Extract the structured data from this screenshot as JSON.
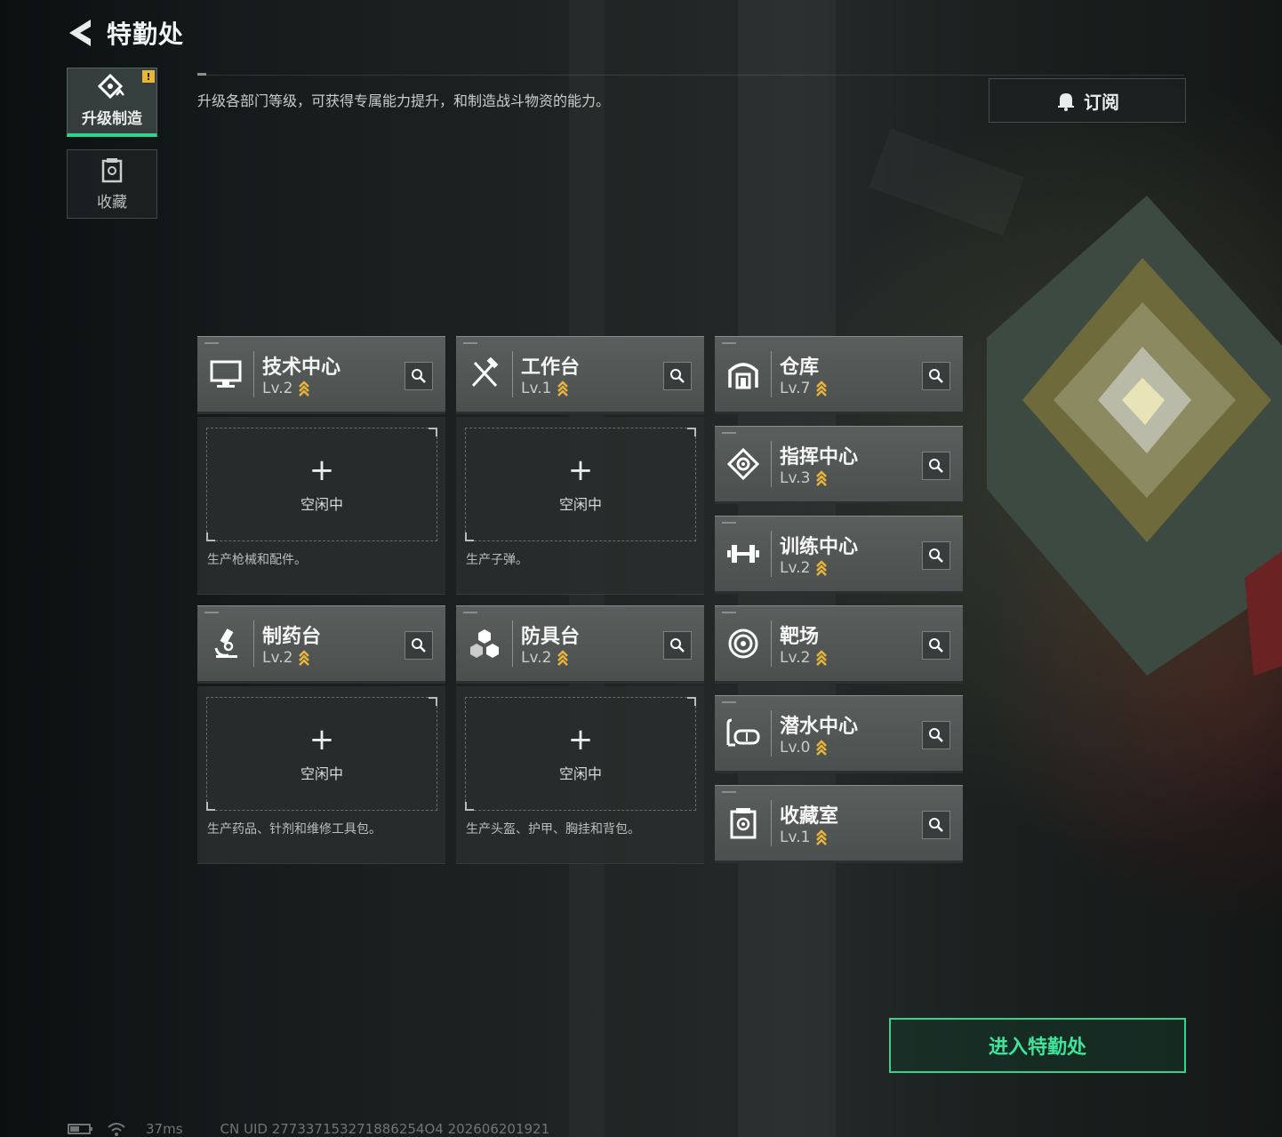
{
  "header": {
    "title": "特勤处",
    "back_icon": "back-arrow-icon"
  },
  "sidebar": {
    "tabs": [
      {
        "label": "升级制造",
        "icon": "upgrade-icon",
        "active": true,
        "badge": "!"
      },
      {
        "label": "收藏",
        "icon": "collection-icon",
        "active": false
      }
    ]
  },
  "description": "升级各部门等级，可获得专属能力提升，和制造战斗物资的能力。",
  "subscribe": {
    "label": "订阅",
    "icon": "bell-icon"
  },
  "level_prefix": "Lv.",
  "production": [
    {
      "name": "技术中心",
      "level": "Lv.2",
      "icon": "monitor-icon",
      "slot_plus": "+",
      "slot_status": "空闲中",
      "desc": "生产枪械和配件。"
    },
    {
      "name": "工作台",
      "level": "Lv.1",
      "icon": "tools-icon",
      "slot_plus": "+",
      "slot_status": "空闲中",
      "desc": "生产子弹。"
    },
    {
      "name": "制药台",
      "level": "Lv.2",
      "icon": "microscope-icon",
      "slot_plus": "+",
      "slot_status": "空闲中",
      "desc": "生产药品、针剂和维修工具包。"
    },
    {
      "name": "防具台",
      "level": "Lv.2",
      "icon": "armor-icon",
      "slot_plus": "+",
      "slot_status": "空闲中",
      "desc": "生产头盔、护甲、胸挂和背包。"
    }
  ],
  "departments": [
    {
      "name": "仓库",
      "level": "Lv.7",
      "icon": "warehouse-icon"
    },
    {
      "name": "指挥中心",
      "level": "Lv.3",
      "icon": "command-icon"
    },
    {
      "name": "训练中心",
      "level": "Lv.2",
      "icon": "dumbbell-icon"
    },
    {
      "name": "靶场",
      "level": "Lv.2",
      "icon": "target-icon"
    },
    {
      "name": "潜水中心",
      "level": "Lv.0",
      "icon": "diving-mask-icon"
    },
    {
      "name": "收藏室",
      "level": "Lv.1",
      "icon": "collection-room-icon"
    }
  ],
  "enter_button": "进入特勤处",
  "footer": {
    "ping": "37ms",
    "uid": "CN UID 277337153271886254O4 202606201921"
  },
  "colors": {
    "accent": "#2fd58a",
    "upgrade_arrow": "#e8b53a",
    "card": "#55595a"
  }
}
